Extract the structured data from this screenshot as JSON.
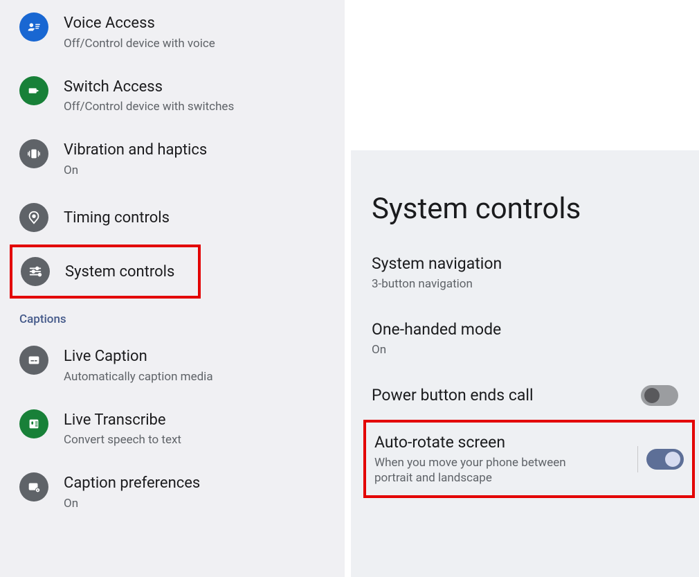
{
  "sidebar": {
    "items": [
      {
        "title": "Voice Access",
        "sub": "Off/Control device with voice"
      },
      {
        "title": "Switch Access",
        "sub": "Off/Control device with switches"
      },
      {
        "title": "Vibration and haptics",
        "sub": "On"
      },
      {
        "title": "Timing controls",
        "sub": ""
      },
      {
        "title": "System controls",
        "sub": ""
      },
      {
        "title": "Live Caption",
        "sub": "Automatically caption media"
      },
      {
        "title": "Live Transcribe",
        "sub": "Convert speech to text"
      },
      {
        "title": "Caption preferences",
        "sub": "On"
      }
    ],
    "section_header": "Captions"
  },
  "detail": {
    "title": "System controls",
    "items": [
      {
        "title": "System navigation",
        "sub": "3-button navigation"
      },
      {
        "title": "One-handed mode",
        "sub": "On"
      },
      {
        "title": "Power button ends call",
        "sub": "",
        "toggle": "off"
      },
      {
        "title": "Auto-rotate screen",
        "sub": "When you move your phone between portrait and landscape",
        "toggle": "on"
      }
    ]
  }
}
